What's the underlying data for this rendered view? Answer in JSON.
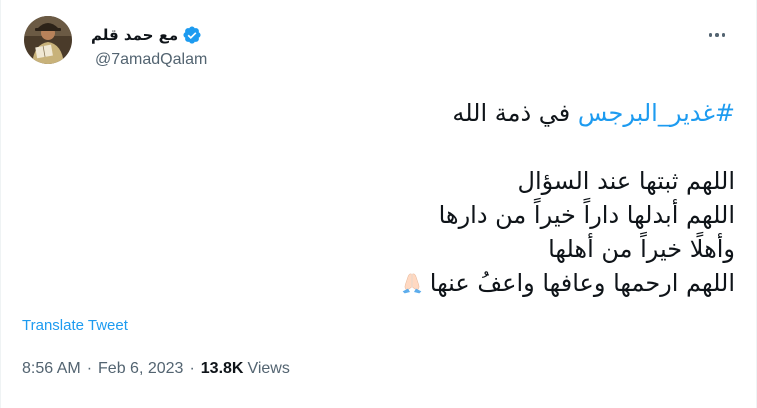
{
  "author": {
    "display_name": "مع حمد قلم",
    "handle": "@7amadQalam",
    "verified": true
  },
  "tweet": {
    "hashtag": "#غدير_البرجس",
    "line1_suffix": " في ذمة الله",
    "lines": [
      "اللهم ثبتها عند السؤال",
      "اللهم أبدلها داراً خيراً من دارها",
      "وأهلًا خيراً من أهلها",
      "اللهم ارحمها وعافها واعفُ عنها"
    ],
    "emoji": "folded-hands"
  },
  "translate_label": "Translate Tweet",
  "meta": {
    "time": "8:56 AM",
    "separator": "·",
    "date": "Feb 6, 2023",
    "views_count": "13.8K",
    "views_label": "Views"
  },
  "colors": {
    "link": "#1d9bf0",
    "text": "#0f1419",
    "secondary": "#536471"
  }
}
